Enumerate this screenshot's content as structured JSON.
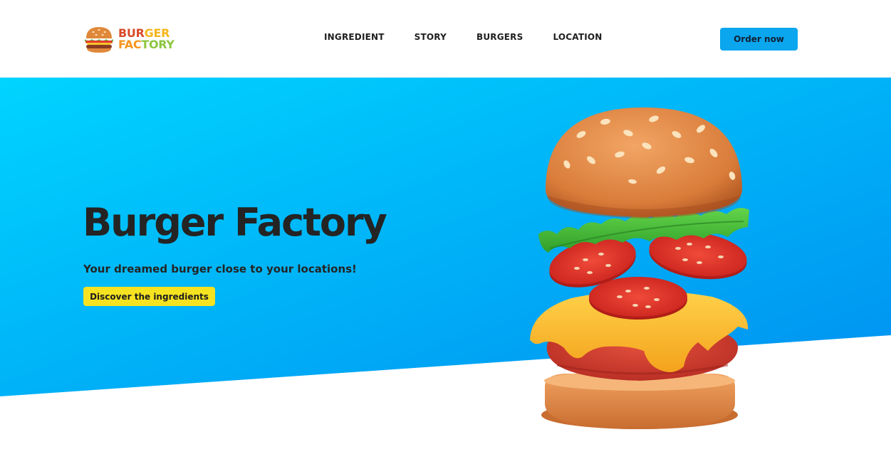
{
  "header": {
    "logo": {
      "line1_part1": "BUR",
      "line1_part2": "GER",
      "line2_part1": "FAC",
      "line2_part2": "TORY",
      "icon": "burger-logo-icon"
    },
    "nav": [
      {
        "label": "INGREDIENT"
      },
      {
        "label": "STORY"
      },
      {
        "label": "BURGERS"
      },
      {
        "label": "LOCATION"
      }
    ],
    "order_button": "Order now"
  },
  "hero": {
    "title": "Burger Factory",
    "subtitle": "Your dreamed burger close to your locations!",
    "cta": "Discover the ingredients",
    "illustration": "burger-illustration"
  },
  "colors": {
    "hero_gradient_start": "#00d4ff",
    "hero_gradient_end": "#0090f0",
    "order_button": "#0aa6ee",
    "cta_button": "#f5e321",
    "text_dark": "#242424"
  }
}
